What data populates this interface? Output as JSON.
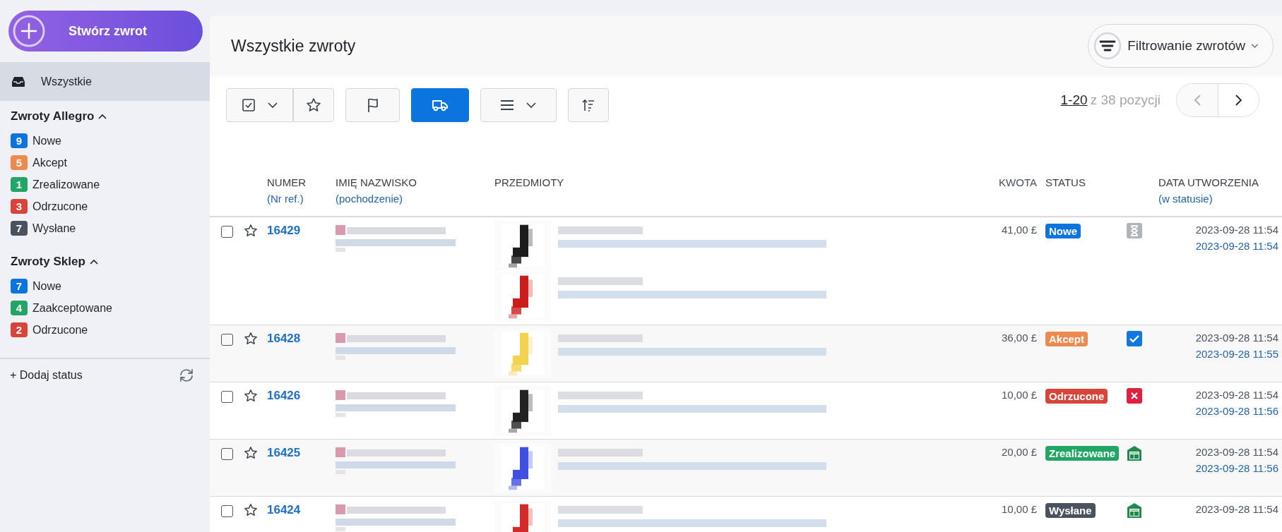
{
  "sidebar": {
    "create_button": "Stwórz zwrot",
    "all_item": {
      "label": "Wszystkie",
      "selected": true
    },
    "groups": [
      {
        "title": "Zwroty Allegro",
        "expanded": true,
        "items": [
          {
            "count": "9",
            "label": "Nowe",
            "color": "#0b74de"
          },
          {
            "count": "5",
            "label": "Akcept",
            "color": "#ec8a4f"
          },
          {
            "count": "1",
            "label": "Zrealizowane",
            "color": "#22a565"
          },
          {
            "count": "3",
            "label": "Odrzucone",
            "color": "#d9443a"
          },
          {
            "count": "7",
            "label": "Wysłane",
            "color": "#4a525d"
          }
        ]
      },
      {
        "title": "Zwroty Sklep",
        "expanded": true,
        "items": [
          {
            "count": "7",
            "label": "Nowe",
            "color": "#0b74de"
          },
          {
            "count": "4",
            "label": "Zaakceptowane",
            "color": "#22a565"
          },
          {
            "count": "2",
            "label": "Odrzucone",
            "color": "#d9443a"
          }
        ]
      }
    ],
    "add_status": "+ Dodaj status"
  },
  "main": {
    "title": "Wszystkie zwroty",
    "filter_button": "Filtrowanie zwrotów",
    "toolbar": [
      {
        "kind": "select",
        "selected": false
      },
      {
        "kind": "star",
        "selected": false
      },
      {
        "kind": "flag",
        "selected": false
      },
      {
        "kind": "truck",
        "selected": true
      },
      {
        "kind": "list",
        "selected": false
      },
      {
        "kind": "sort",
        "selected": false
      }
    ],
    "pagination": {
      "range": "1-20",
      "total": "z 38 pozycji",
      "prev_disabled": true
    }
  },
  "table": {
    "columns": [
      {
        "title": "NUMER",
        "subtitle": "(Nr ref.)"
      },
      {
        "title": "IMIĘ NAZWISKO",
        "subtitle": "(pochodzenie)"
      },
      {
        "title": "PRZEDMIOTY"
      },
      {
        "title": "KWOTA"
      },
      {
        "title": "STATUS"
      },
      {
        "title": "DATA UTWORZENIA",
        "subtitle": "(w statusie)"
      }
    ],
    "rows": [
      {
        "checked": false,
        "starred": false,
        "number": "16429",
        "amount": "41,00 £",
        "status": {
          "label": "Nowe",
          "color": "#0b74de"
        },
        "kind": "pending",
        "created": "2023-09-28 11:54",
        "changed": "2023-09-28 11:54"
      },
      {
        "checked": false,
        "starred": false,
        "number": "16428",
        "amount": "36,00 £",
        "status": {
          "label": "Akcept",
          "color": "#ec8a4f"
        },
        "kind": "accepted",
        "created": "2023-09-28 11:54",
        "changed": "2023-09-28 11:55"
      },
      {
        "checked": false,
        "starred": false,
        "number": "16426",
        "amount": "10,00 £",
        "status": {
          "label": "Odrzucone",
          "color": "#d9443a"
        },
        "kind": "rejected",
        "created": "2023-09-28 11:54",
        "changed": "2023-09-28 11:56"
      },
      {
        "checked": false,
        "starred": false,
        "number": "16425",
        "amount": "20,00 £",
        "status": {
          "label": "Zrealizowane",
          "color": "#22a565"
        },
        "kind": "warehouse",
        "created": "2023-09-28 11:54",
        "changed": "2023-09-28 11:56"
      },
      {
        "checked": false,
        "starred": false,
        "number": "16424",
        "amount": "10,00 £",
        "status": {
          "label": "Wysłane",
          "color": "#4a525d"
        },
        "kind": "warehouse",
        "created": "2023-09-28 11:54"
      }
    ]
  }
}
